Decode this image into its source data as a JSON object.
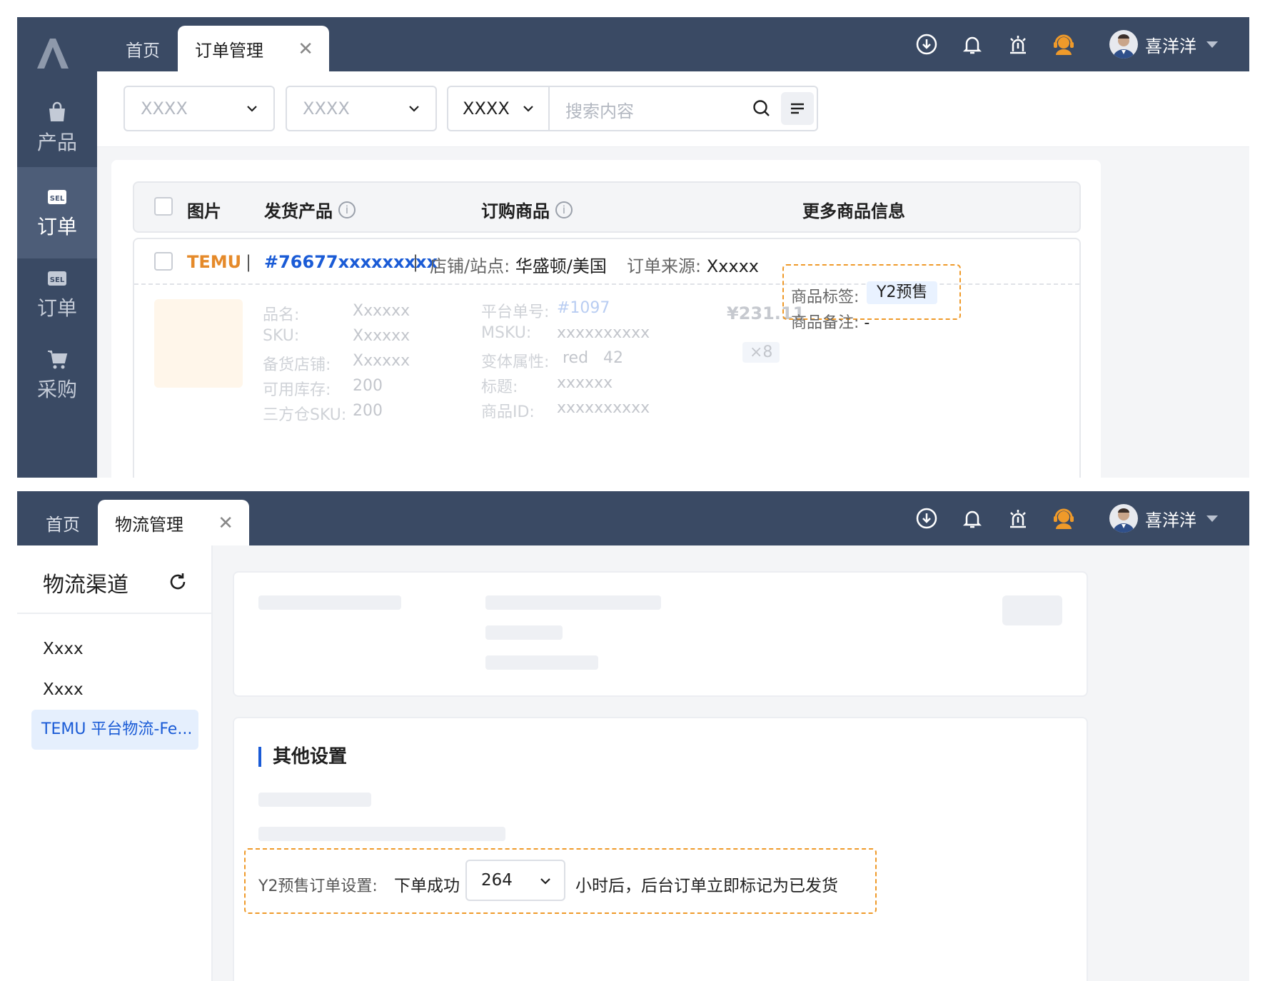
{
  "user": {
    "name": "喜洋洋"
  },
  "screen1": {
    "tabs": {
      "home": "首页",
      "active": "订单管理"
    },
    "sidebar": [
      {
        "label": "产品",
        "icon": "bag-icon"
      },
      {
        "label": "订单",
        "icon": "sel-order-icon",
        "active": true
      },
      {
        "label": "订单",
        "icon": "sel-order-icon"
      },
      {
        "label": "采购",
        "icon": "cart-icon"
      }
    ],
    "filters": {
      "select1": "XXXX",
      "select2": "XXXX",
      "search_type": "XXXX",
      "search_placeholder": "搜索内容"
    },
    "table_headers": {
      "image": "图片",
      "ship_product": "发货产品",
      "order_goods": "订购商品",
      "more_info": "更多商品信息"
    },
    "order": {
      "platform": "TEMU",
      "number": "#76677xxxxxxxxx",
      "shop_label": "店铺/站点:",
      "shop_value": "华盛顿/美国",
      "source_label": "订单来源:",
      "source_value": "Xxxxx",
      "ship_fields": [
        {
          "label": "品名:",
          "value": "Xxxxxx"
        },
        {
          "label": "SKU:",
          "value": "Xxxxxx"
        },
        {
          "label": "备货店铺:",
          "value": "Xxxxxx"
        },
        {
          "label": "可用库存:",
          "value": "200"
        },
        {
          "label": "三方仓SKU:",
          "value": "200"
        }
      ],
      "order_fields": [
        {
          "label": "平台单号:",
          "value": "#1097"
        },
        {
          "label": "MSKU:",
          "value": "xxxxxxxxxx"
        },
        {
          "label": "变体属性:",
          "value": "red   42"
        },
        {
          "label": "标题:",
          "value": "xxxxxx"
        },
        {
          "label": "商品ID:",
          "value": "xxxxxxxxxx"
        }
      ],
      "price": "¥231.11",
      "quantity": "×8",
      "tag_label": "商品标签:",
      "tag_value": "Y2预售",
      "note_label": "商品备注:",
      "note_value": "-"
    }
  },
  "screen2": {
    "tabs": {
      "home": "首页",
      "active": "物流管理"
    },
    "channel_title": "物流渠道",
    "channels": [
      "Xxxx",
      "Xxxx"
    ],
    "active_channel": "TEMU 平台物流-Fe...",
    "section_title": "其他设置",
    "y2_setting": {
      "label": "Y2预售订单设置:",
      "prefix": "下单成功",
      "hours": "264",
      "suffix": "小时后，后台订单立即标记为已发货"
    }
  },
  "colors": {
    "header": "#3a4a64",
    "accent": "#1a5bd6",
    "highlight": "#ef9a2a",
    "temu": "#e58a2a"
  }
}
